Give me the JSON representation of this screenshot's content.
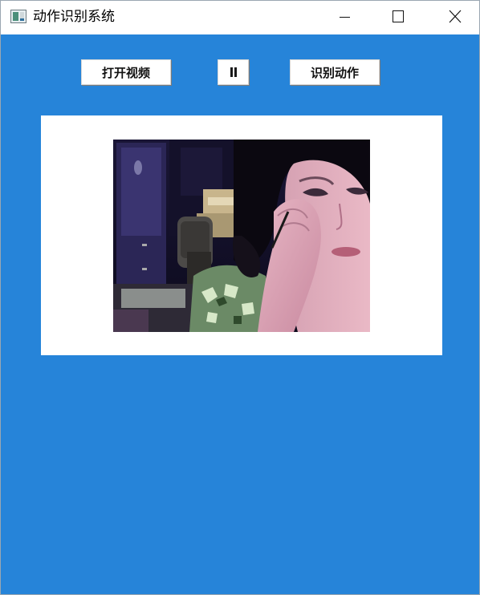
{
  "window": {
    "title": "动作识别系统",
    "controls": {
      "minimize": "minimize-icon",
      "maximize": "maximize-icon",
      "close": "close-icon"
    }
  },
  "toolbar": {
    "open_video_label": "打开视频",
    "pause_icon": "pause-icon",
    "recognize_label": "识别动作"
  },
  "video": {
    "content": "video-frame"
  },
  "colors": {
    "client_background": "#2684d9",
    "panel_background": "#ffffff"
  }
}
